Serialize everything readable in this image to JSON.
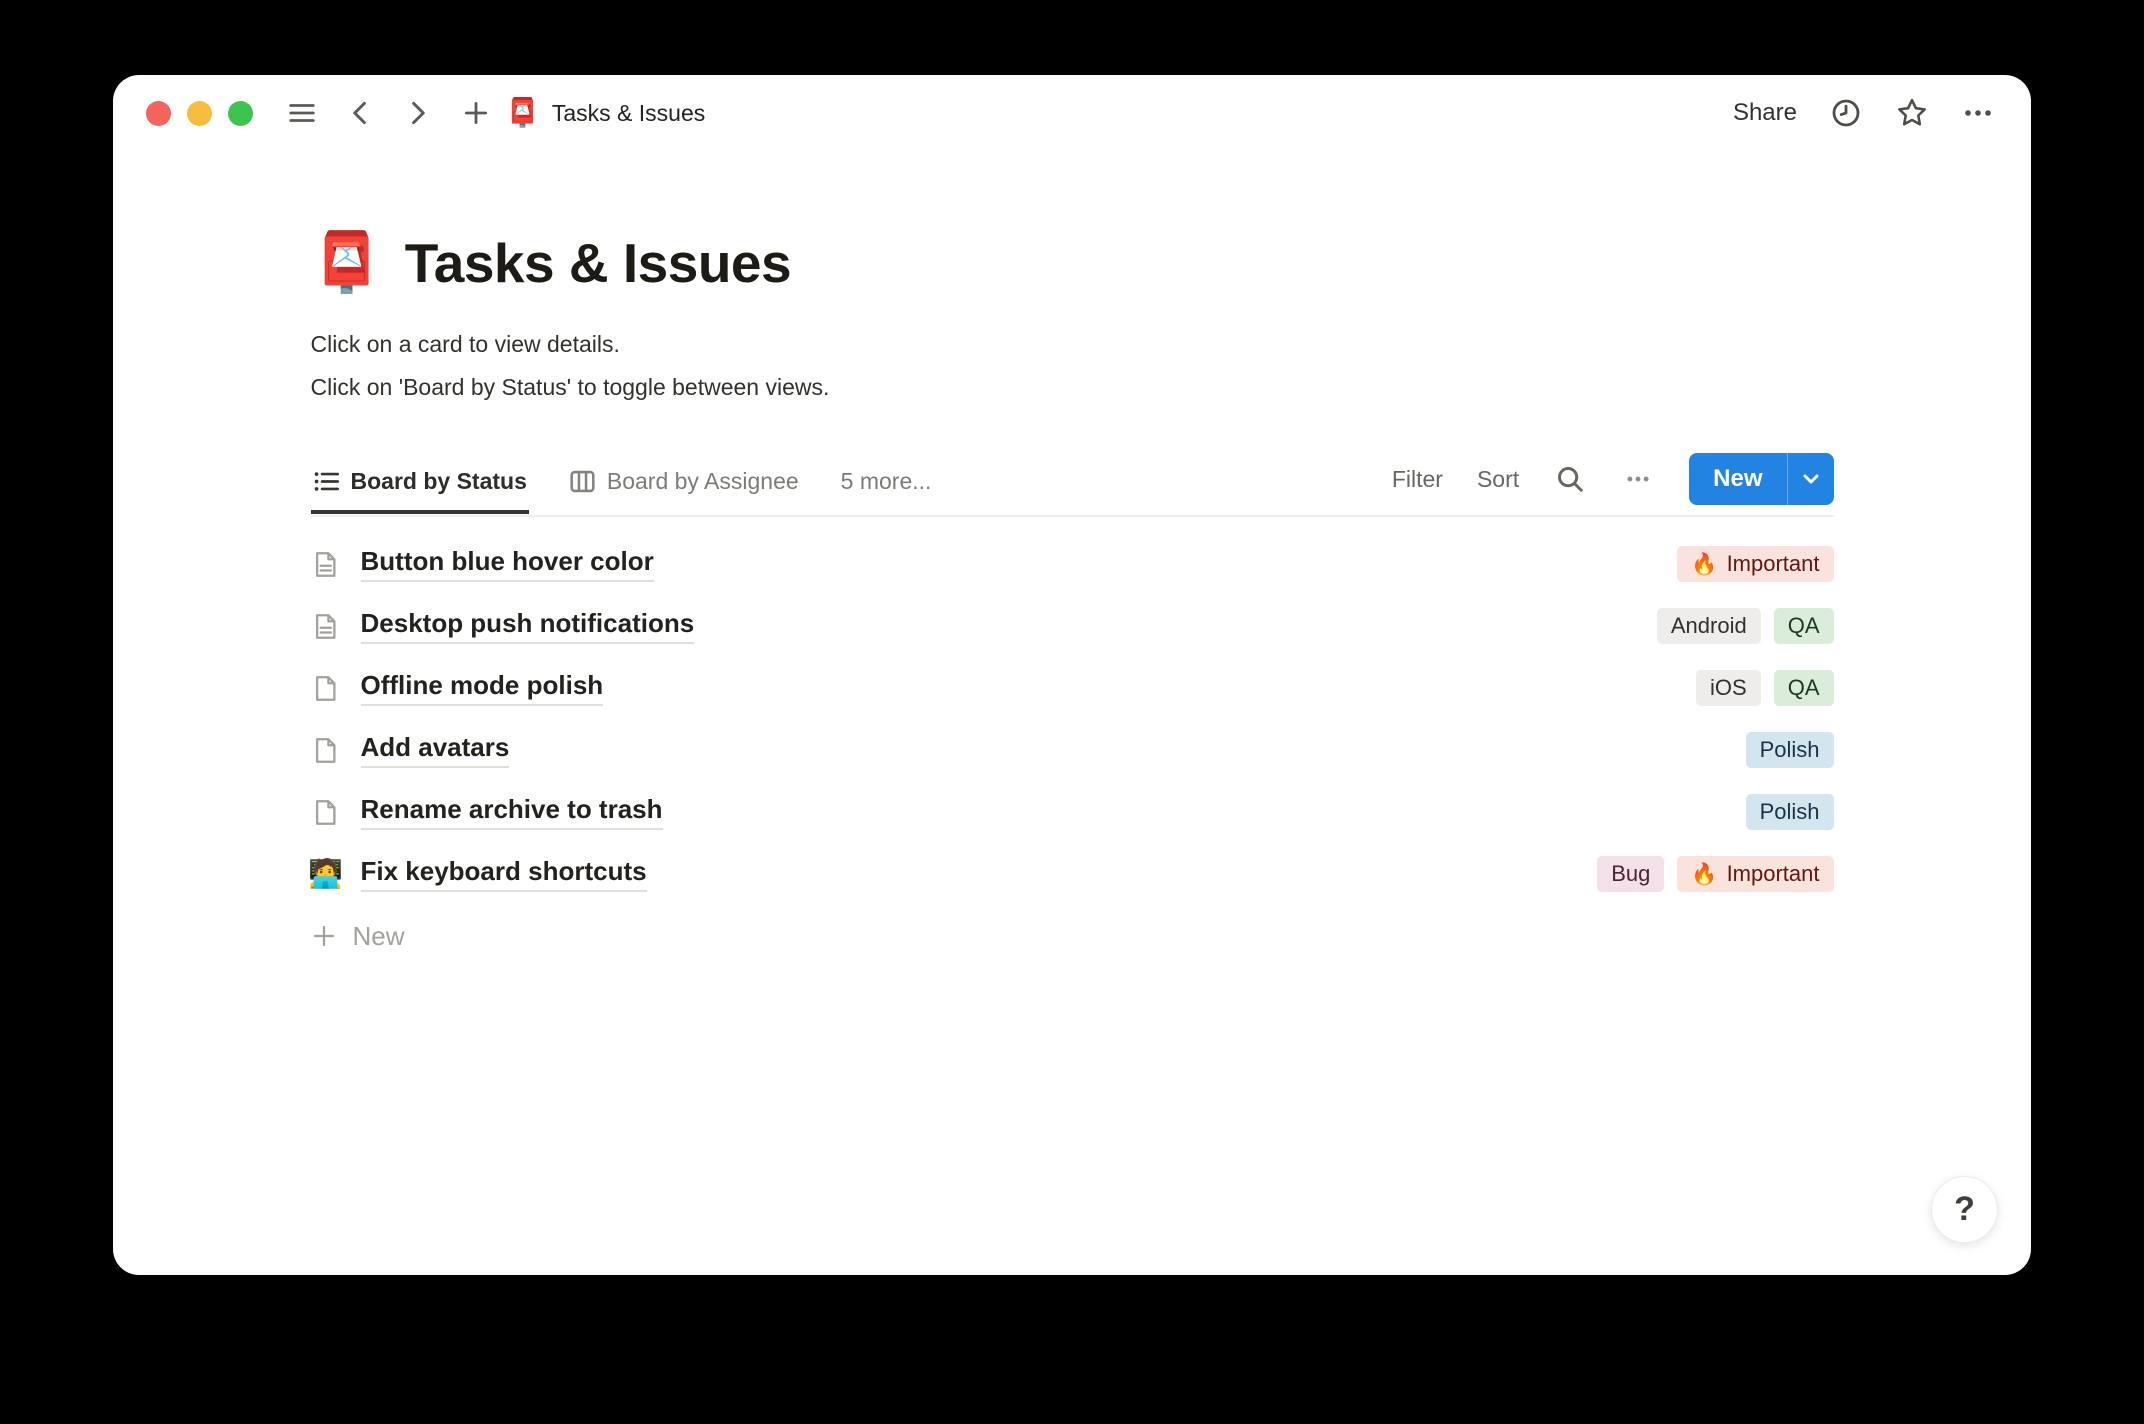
{
  "colors": {
    "accent_blue": "#2383e2",
    "desktop_bg": "#000000",
    "window_bg": "#ffffff",
    "tag_red_bg": "#fbe3dd",
    "tag_red_text": "#5d1715",
    "tag_gray_bg": "#eeedeb",
    "tag_gray_text": "#32302c",
    "tag_green_bg": "#dbecda",
    "tag_green_text": "#1c3829",
    "tag_blue_bg": "#d3e5ef",
    "tag_blue_text": "#183347",
    "tag_pink_bg": "#f4e0e8",
    "tag_pink_text": "#4c2337"
  },
  "titlebar": {
    "doc_emoji": "📮",
    "doc_title": "Tasks & Issues",
    "share_label": "Share"
  },
  "page": {
    "emoji": "📮",
    "title": "Tasks & Issues",
    "description": [
      "Click on a card to view details.",
      "Click on 'Board by Status' to toggle between views."
    ]
  },
  "toolbar": {
    "tabs": [
      {
        "label": "Board by Status",
        "icon": "list",
        "active": true
      },
      {
        "label": "Board by Assignee",
        "icon": "board",
        "active": false
      },
      {
        "label": "5 more...",
        "icon": "none",
        "active": false
      }
    ],
    "filter_label": "Filter",
    "sort_label": "Sort",
    "new_label": "New"
  },
  "rows": [
    {
      "icon": "page-text",
      "emoji": "",
      "title": "Button blue hover color",
      "tags": [
        {
          "label": "Important",
          "emoji": "🔥",
          "color": "red"
        }
      ]
    },
    {
      "icon": "page-text",
      "emoji": "",
      "title": "Desktop push notifications",
      "tags": [
        {
          "label": "Android",
          "emoji": "",
          "color": "gray"
        },
        {
          "label": "QA",
          "emoji": "",
          "color": "green"
        }
      ]
    },
    {
      "icon": "page-blank",
      "emoji": "",
      "title": "Offline mode polish",
      "tags": [
        {
          "label": "iOS",
          "emoji": "",
          "color": "gray"
        },
        {
          "label": "QA",
          "emoji": "",
          "color": "green"
        }
      ]
    },
    {
      "icon": "page-blank",
      "emoji": "",
      "title": "Add avatars",
      "tags": [
        {
          "label": "Polish",
          "emoji": "",
          "color": "blue"
        }
      ]
    },
    {
      "icon": "page-blank",
      "emoji": "",
      "title": "Rename archive to trash",
      "tags": [
        {
          "label": "Polish",
          "emoji": "",
          "color": "blue"
        }
      ]
    },
    {
      "icon": "emoji",
      "emoji": "🧑‍💻",
      "title": "Fix keyboard shortcuts",
      "tags": [
        {
          "label": "Bug",
          "emoji": "",
          "color": "pink"
        },
        {
          "label": "Important",
          "emoji": "🔥",
          "color": "red"
        }
      ]
    }
  ],
  "footer": {
    "new_label": "New"
  },
  "help": {
    "label": "?"
  }
}
